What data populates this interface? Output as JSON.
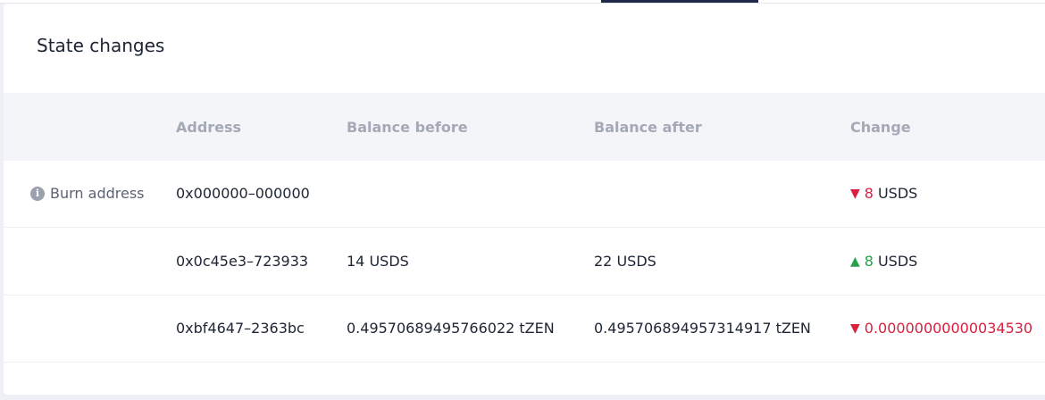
{
  "card": {
    "title": "State changes"
  },
  "table": {
    "headers": {
      "address": "Address",
      "balance_before": "Balance before",
      "balance_after": "Balance after",
      "change": "Change"
    },
    "rows": [
      {
        "label": "Burn address",
        "label_icon": "info-icon",
        "address": "0x000000–000000",
        "balance_before": "",
        "balance_after": "",
        "change_direction": "down",
        "change_arrow": "▼",
        "change_amount": "8",
        "change_unit": "USDS"
      },
      {
        "label": "",
        "address": "0x0c45e3–723933",
        "balance_before": "14 USDS",
        "balance_after": "22 USDS",
        "change_direction": "up",
        "change_arrow": "▲",
        "change_amount": "8",
        "change_unit": "USDS"
      },
      {
        "label": "",
        "address": "0xbf4647–2363bc",
        "balance_before": "0.49570689495766022 tZEN",
        "balance_after": "0.495706894957314917 tZEN",
        "change_direction": "down",
        "change_arrow": "▼",
        "change_amount": "0.00000000000034530",
        "change_unit": ""
      }
    ]
  },
  "colors": {
    "negative": "#d9203f",
    "positive": "#27a14a",
    "header_bg": "#f4f5f9",
    "active_tab": "#1e2a48"
  }
}
